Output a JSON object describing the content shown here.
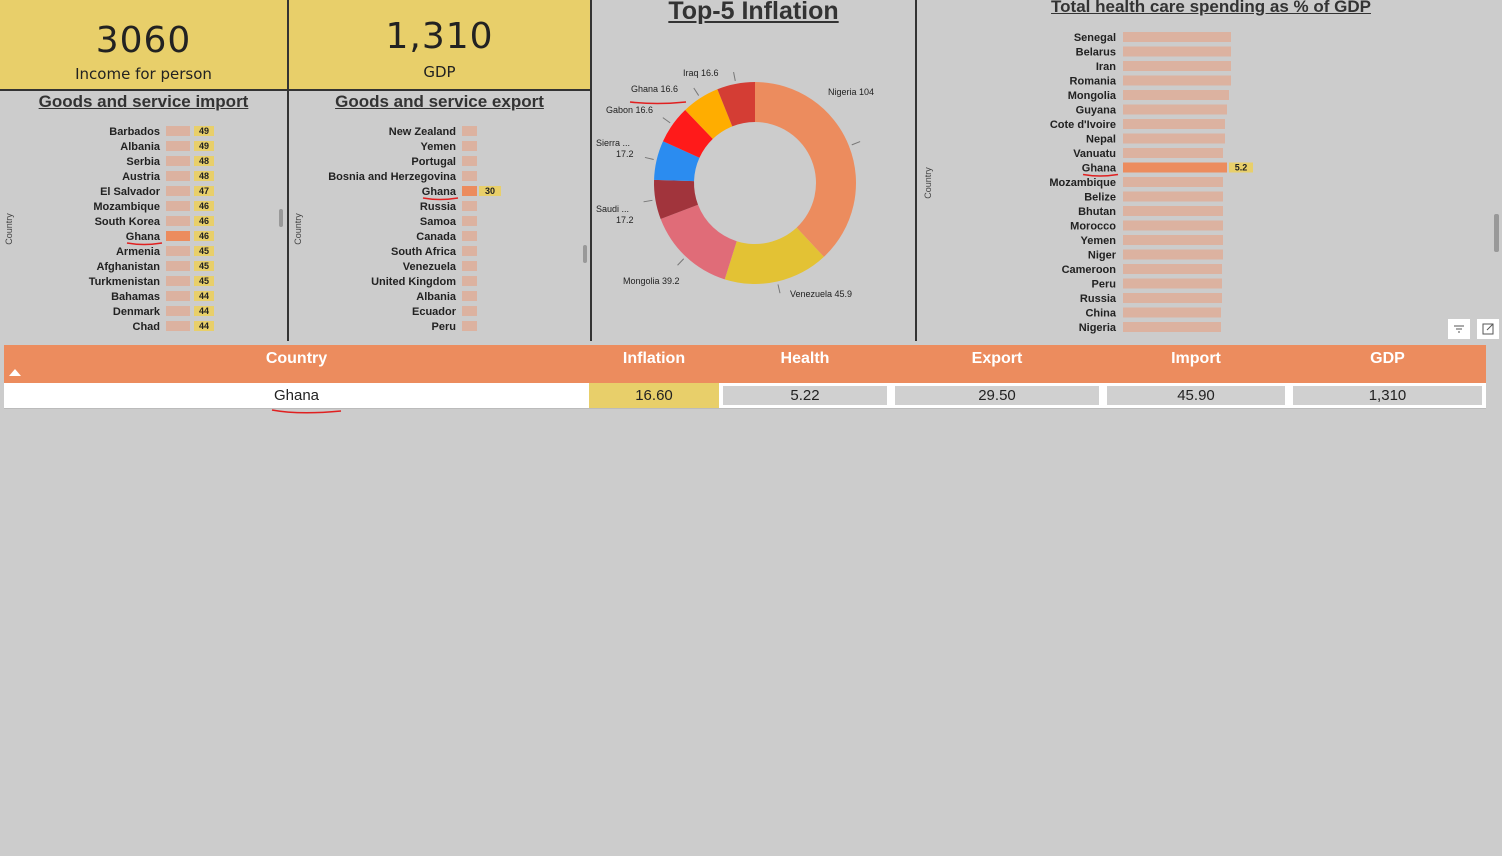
{
  "kpis": {
    "income": {
      "value": "3060",
      "label": "Income for person"
    },
    "gdp": {
      "value": "1,310",
      "label": "GDP"
    }
  },
  "colors": {
    "bar": "#dcb2a0",
    "highlight": "#ec8c5e",
    "label_bg": "#e8cf6a",
    "red_underline": "#e02020"
  },
  "chart_data": [
    {
      "type": "bar",
      "orientation": "horizontal",
      "title": "Goods and service import",
      "ylabel": "Country",
      "categories": [
        "Barbados",
        "Albania",
        "Serbia",
        "Austria",
        "El Salvador",
        "Mozambique",
        "South Korea",
        "Ghana",
        "Armenia",
        "Afghanistan",
        "Turkmenistan",
        "Bahamas",
        "Denmark",
        "Chad"
      ],
      "values": [
        49,
        49,
        48,
        48,
        47,
        46,
        46,
        46,
        45,
        45,
        45,
        44,
        44,
        44
      ],
      "labels": [
        "49",
        "49",
        "48",
        "48",
        "47",
        "46",
        "46",
        "46",
        "45",
        "45",
        "45",
        "44",
        "44",
        "44"
      ],
      "highlight": "Ghana"
    },
    {
      "type": "bar",
      "orientation": "horizontal",
      "title": "Goods and service export",
      "ylabel": "Country",
      "categories": [
        "New Zealand",
        "Yemen",
        "Portugal",
        "Bosnia and Herzegovina",
        "Ghana",
        "Russia",
        "Samoa",
        "Canada",
        "South Africa",
        "Venezuela",
        "United Kingdom",
        "Albania",
        "Ecuador",
        "Peru"
      ],
      "values": [
        30,
        30,
        30,
        30,
        30,
        30,
        30,
        30,
        30,
        30,
        30,
        30,
        30,
        30
      ],
      "labels": [
        "",
        "",
        "",
        "",
        "30",
        "",
        "",
        "",
        "",
        "",
        "",
        "",
        "",
        ""
      ],
      "highlight": "Ghana"
    },
    {
      "type": "pie",
      "title": "Top-5 Inflation",
      "slices": [
        {
          "label": "Nigeria 104",
          "value": 104,
          "color": "#ec8c5e"
        },
        {
          "label": "Venezuela 45.9",
          "value": 45.9,
          "color": "#e3c234"
        },
        {
          "label": "Mongolia 39.2",
          "value": 39.2,
          "color": "#e06c78"
        },
        {
          "label": "Saudi ... 17.2",
          "value": 17.2,
          "color": "#a1343c"
        },
        {
          "label": "Sierra ... 17.2",
          "value": 17.2,
          "color": "#2b8cf0"
        },
        {
          "label": "Gabon 16.6",
          "value": 16.6,
          "color": "#ff1a1a"
        },
        {
          "label": "Ghana 16.6",
          "value": 16.6,
          "color": "#ffad00"
        },
        {
          "label": "Iraq 16.6",
          "value": 16.6,
          "color": "#d43d34"
        }
      ]
    },
    {
      "type": "bar",
      "orientation": "horizontal",
      "title": "Total health care spending as % of GDP",
      "ylabel": "Country",
      "categories": [
        "Senegal",
        "Belarus",
        "Iran",
        "Romania",
        "Mongolia",
        "Guyana",
        "Cote d'Ivoire",
        "Nepal",
        "Vanuatu",
        "Ghana",
        "Mozambique",
        "Belize",
        "Bhutan",
        "Morocco",
        "Yemen",
        "Niger",
        "Cameroon",
        "Peru",
        "Russia",
        "China",
        "Nigeria"
      ],
      "values": [
        5.4,
        5.4,
        5.4,
        5.4,
        5.3,
        5.2,
        5.1,
        5.1,
        5.0,
        5.2,
        5.0,
        5.0,
        5.0,
        5.0,
        5.0,
        5.0,
        4.95,
        4.95,
        4.95,
        4.9,
        4.9
      ],
      "labels": [
        "",
        "",
        "",
        "",
        "",
        "",
        "",
        "",
        "",
        "5.2",
        "",
        "",
        "",
        "",
        "",
        "",
        "",
        "",
        "",
        "",
        ""
      ],
      "highlight": "Ghana"
    }
  ],
  "table": {
    "columns": [
      "Country",
      "Inflation",
      "Health",
      "Export",
      "Import",
      "GDP"
    ],
    "rows": [
      [
        "Ghana",
        "16.60",
        "5.22",
        "29.50",
        "45.90",
        "1,310"
      ]
    ]
  }
}
